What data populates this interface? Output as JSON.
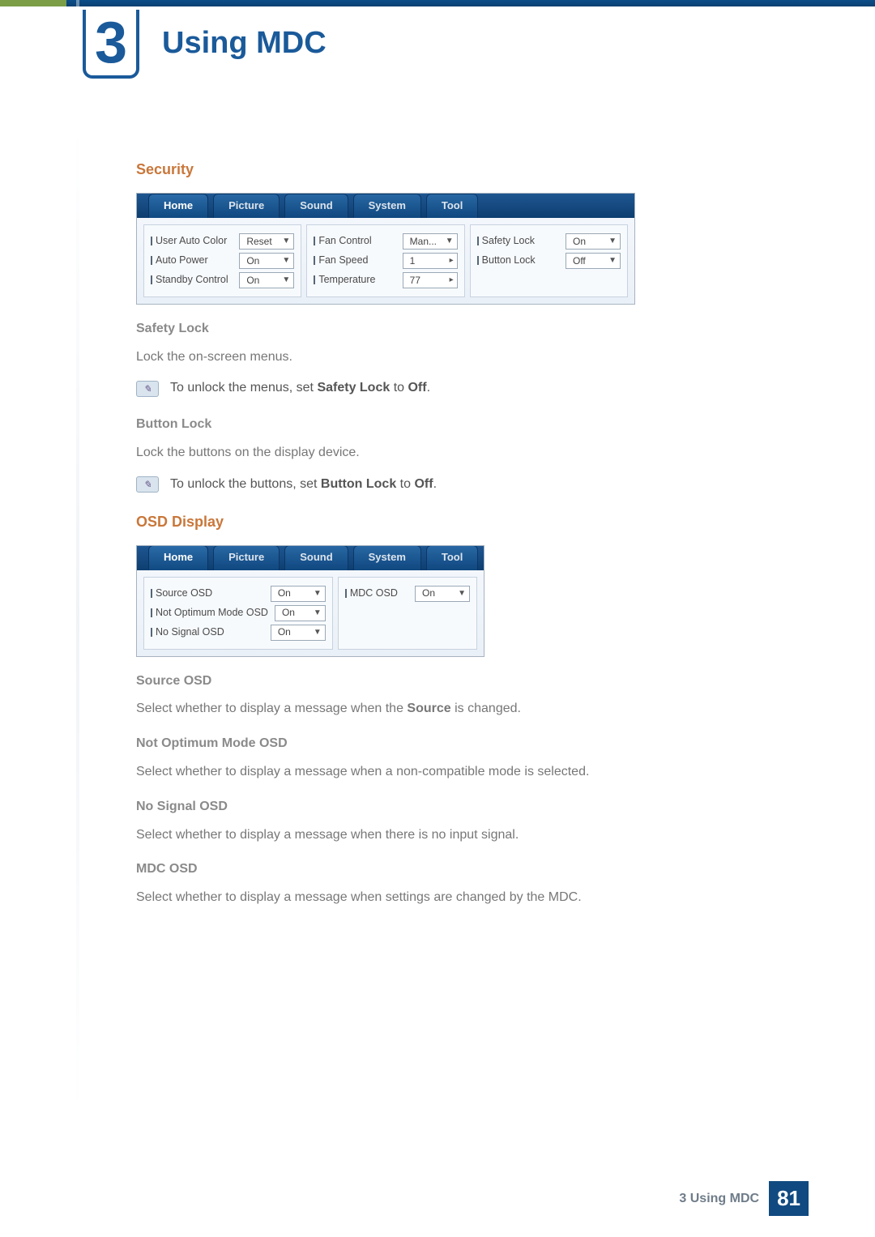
{
  "chapter": {
    "number": "3",
    "title": "Using MDC"
  },
  "sections": {
    "security": {
      "heading": "Security",
      "tabs": [
        "Home",
        "Picture",
        "Sound",
        "System",
        "Tool"
      ],
      "col1": {
        "user_auto_color": {
          "label": "User Auto Color",
          "value": "Reset"
        },
        "auto_power": {
          "label": "Auto Power",
          "value": "On"
        },
        "standby_control": {
          "label": "Standby Control",
          "value": "On"
        }
      },
      "col2": {
        "fan_control": {
          "label": "Fan Control",
          "value": "Man..."
        },
        "fan_speed": {
          "label": "Fan Speed",
          "value": "1"
        },
        "temperature": {
          "label": "Temperature",
          "value": "77"
        }
      },
      "col3": {
        "safety_lock": {
          "label": "Safety Lock",
          "value": "On"
        },
        "button_lock": {
          "label": "Button Lock",
          "value": "Off"
        }
      },
      "safety_lock_h": "Safety Lock",
      "safety_lock_desc": "Lock the on-screen menus.",
      "safety_note_pre": "To unlock the menus, set ",
      "safety_note_bold": "Safety Lock",
      "safety_note_mid": " to ",
      "safety_note_bold2": "Off",
      "button_lock_h": "Button Lock",
      "button_lock_desc": "Lock the buttons on the display device.",
      "button_note_pre": "To unlock the buttons, set ",
      "button_note_bold": "Button Lock",
      "button_note_mid": " to ",
      "button_note_bold2": "Off"
    },
    "osd": {
      "heading": "OSD Display",
      "tabs": [
        "Home",
        "Picture",
        "Sound",
        "System",
        "Tool"
      ],
      "col1": {
        "source_osd": {
          "label": "Source OSD",
          "value": "On"
        },
        "not_optimum": {
          "label": "Not Optimum Mode OSD",
          "value": "On"
        },
        "no_signal": {
          "label": "No Signal OSD",
          "value": "On"
        }
      },
      "col2": {
        "mdc_osd": {
          "label": "MDC OSD",
          "value": "On"
        }
      },
      "source_h": "Source OSD",
      "source_desc_pre": "Select whether to display a message when the ",
      "source_desc_bold": "Source",
      "source_desc_post": " is changed.",
      "notopt_h": "Not Optimum Mode OSD",
      "notopt_desc": "Select whether to display a message when a non-compatible mode is selected.",
      "nosig_h": "No Signal OSD",
      "nosig_desc": "Select whether to display a message when there is no input signal.",
      "mdc_h": "MDC OSD",
      "mdc_desc": "Select whether to display a message when settings are changed by the MDC."
    }
  },
  "footer": {
    "text": "3 Using MDC",
    "page": "81"
  },
  "glyphs": {
    "dropdown": "▼",
    "stepper": "▸",
    "period": "."
  }
}
